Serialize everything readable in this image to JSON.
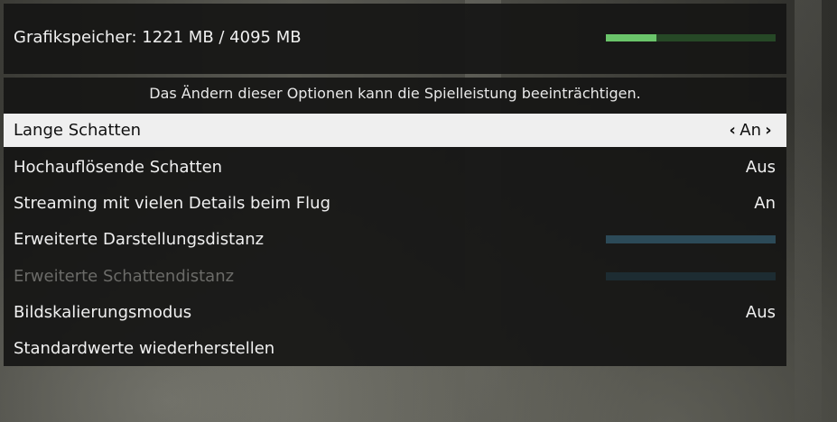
{
  "vram": {
    "label": "Grafikspeicher: 1221 MB / 4095 MB",
    "used_mb": 1221,
    "total_mb": 4095,
    "fill_fraction": 0.298,
    "bar_color": "#6ac46a",
    "track_color": "#264826"
  },
  "warning": "Das Ändern dieser Optionen kann die Spielleistung beeinträchtigen.",
  "settings": [
    {
      "label": "Lange Schatten",
      "value": "An",
      "type": "toggle",
      "selected": true,
      "disabled": false
    },
    {
      "label": "Hochauflösende Schatten",
      "value": "Aus",
      "type": "toggle",
      "selected": false,
      "disabled": false
    },
    {
      "label": "Streaming mit vielen Details beim Flug",
      "value": "An",
      "type": "toggle",
      "selected": false,
      "disabled": false
    },
    {
      "label": "Erweiterte Darstellungsdistanz",
      "type": "slider",
      "level": 1.0,
      "selected": false,
      "disabled": false
    },
    {
      "label": "Erweiterte Schattendistanz",
      "type": "slider",
      "level": 1.0,
      "selected": false,
      "disabled": true
    },
    {
      "label": "Bildskalierungsmodus",
      "value": "Aus",
      "type": "toggle",
      "selected": false,
      "disabled": false
    },
    {
      "label": "Standardwerte wiederherstellen",
      "type": "action",
      "selected": false,
      "disabled": false
    }
  ],
  "icons": {
    "left_arrow": "chevron-left-icon",
    "right_arrow": "chevron-right-icon"
  }
}
